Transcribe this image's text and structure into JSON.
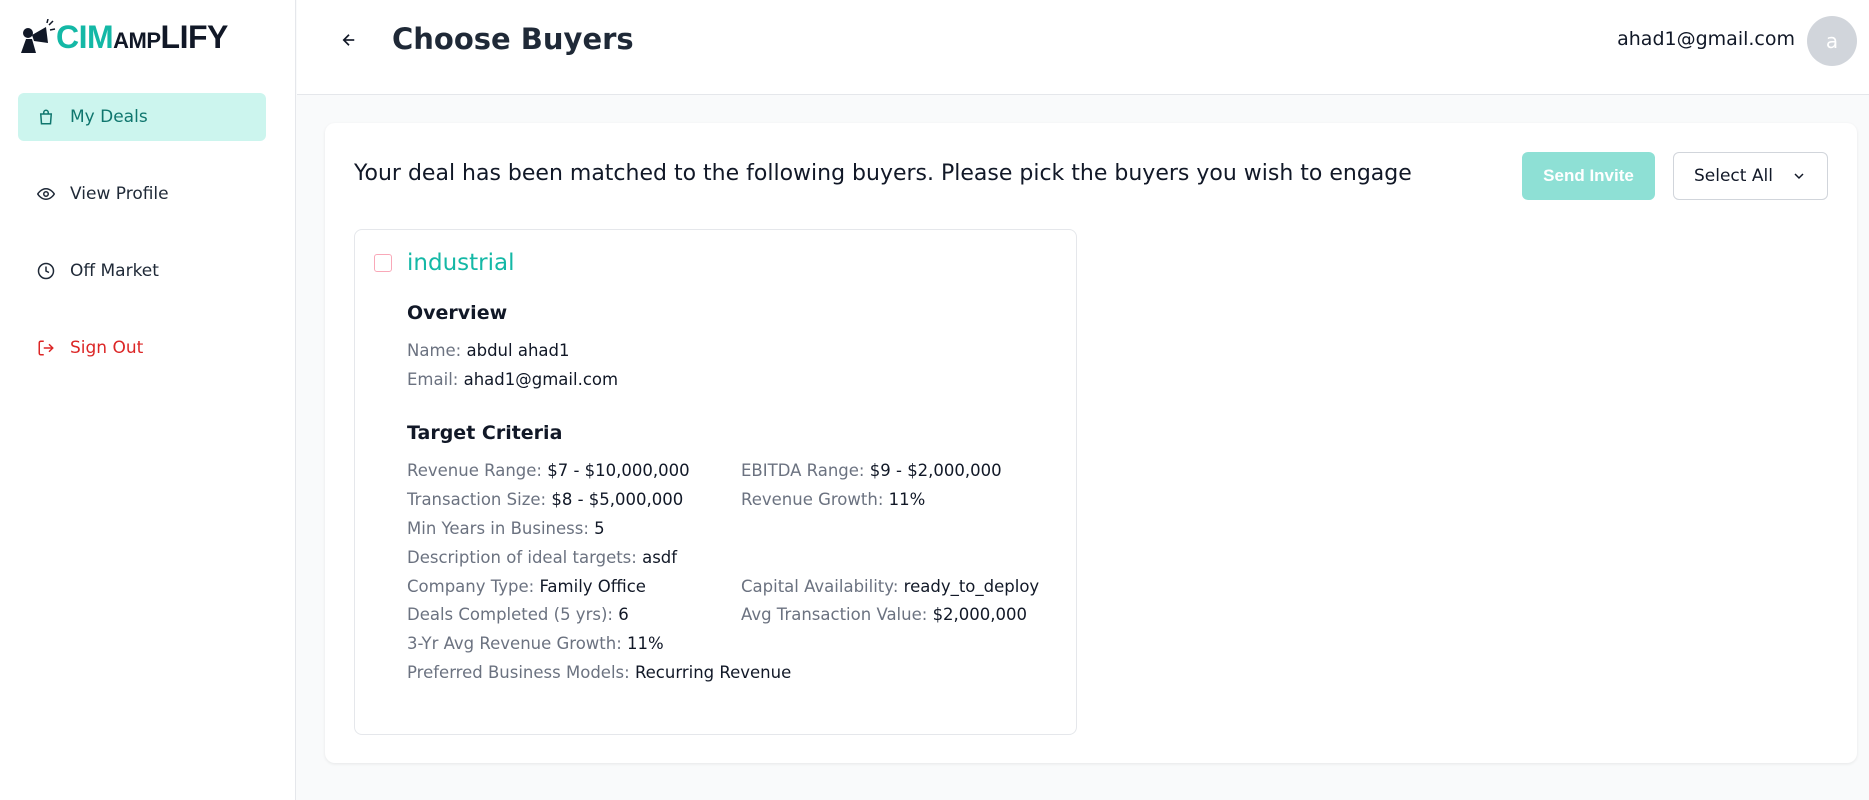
{
  "brand": {
    "part1": "CIM",
    "part2": "AMP",
    "part3": "LIFY"
  },
  "sidebar": {
    "items": [
      {
        "label": "My Deals",
        "icon": "bag-icon"
      },
      {
        "label": "View Profile",
        "icon": "eye-icon"
      },
      {
        "label": "Off Market",
        "icon": "clock-icon"
      },
      {
        "label": "Sign Out",
        "icon": "signout-icon"
      }
    ]
  },
  "header": {
    "title": "Choose Buyers",
    "user_email": "ahad1@gmail.com",
    "avatar_letter": "a"
  },
  "main": {
    "intro": "Your deal has been matched to the following buyers. Please pick the buyers you wish to engage",
    "send_invite_label": "Send Invite",
    "select_all_label": "Select All"
  },
  "buyer": {
    "title": "industrial",
    "overview_title": "Overview",
    "name_key": "Name:",
    "name_val": "abdul ahad1",
    "email_key": "Email:",
    "email_val": "ahad1@gmail.com",
    "criteria_title": "Target Criteria",
    "revenue_range_key": "Revenue Range:",
    "revenue_range_val": "$7 - $10,000,000",
    "ebitda_range_key": "EBITDA Range:",
    "ebitda_range_val": "$9 - $2,000,000",
    "transaction_size_key": "Transaction Size:",
    "transaction_size_val": "$8 - $5,000,000",
    "revenue_growth_key": "Revenue Growth:",
    "revenue_growth_val": "11%",
    "min_years_key": "Min Years in Business:",
    "min_years_val": "5",
    "description_key": "Description of ideal targets:",
    "description_val": "asdf",
    "company_type_key": "Company Type:",
    "company_type_val": "Family Office",
    "capital_key": "Capital Availability:",
    "capital_val": "ready_to_deploy",
    "deals_completed_key": "Deals Completed (5 yrs):",
    "deals_completed_val": "6",
    "avg_transaction_key": "Avg Transaction Value:",
    "avg_transaction_val": "$2,000,000",
    "avg_growth_key": "3-Yr Avg Revenue Growth:",
    "avg_growth_val": "11%",
    "business_models_key": "Preferred Business Models:",
    "business_models_val": "Recurring Revenue"
  }
}
